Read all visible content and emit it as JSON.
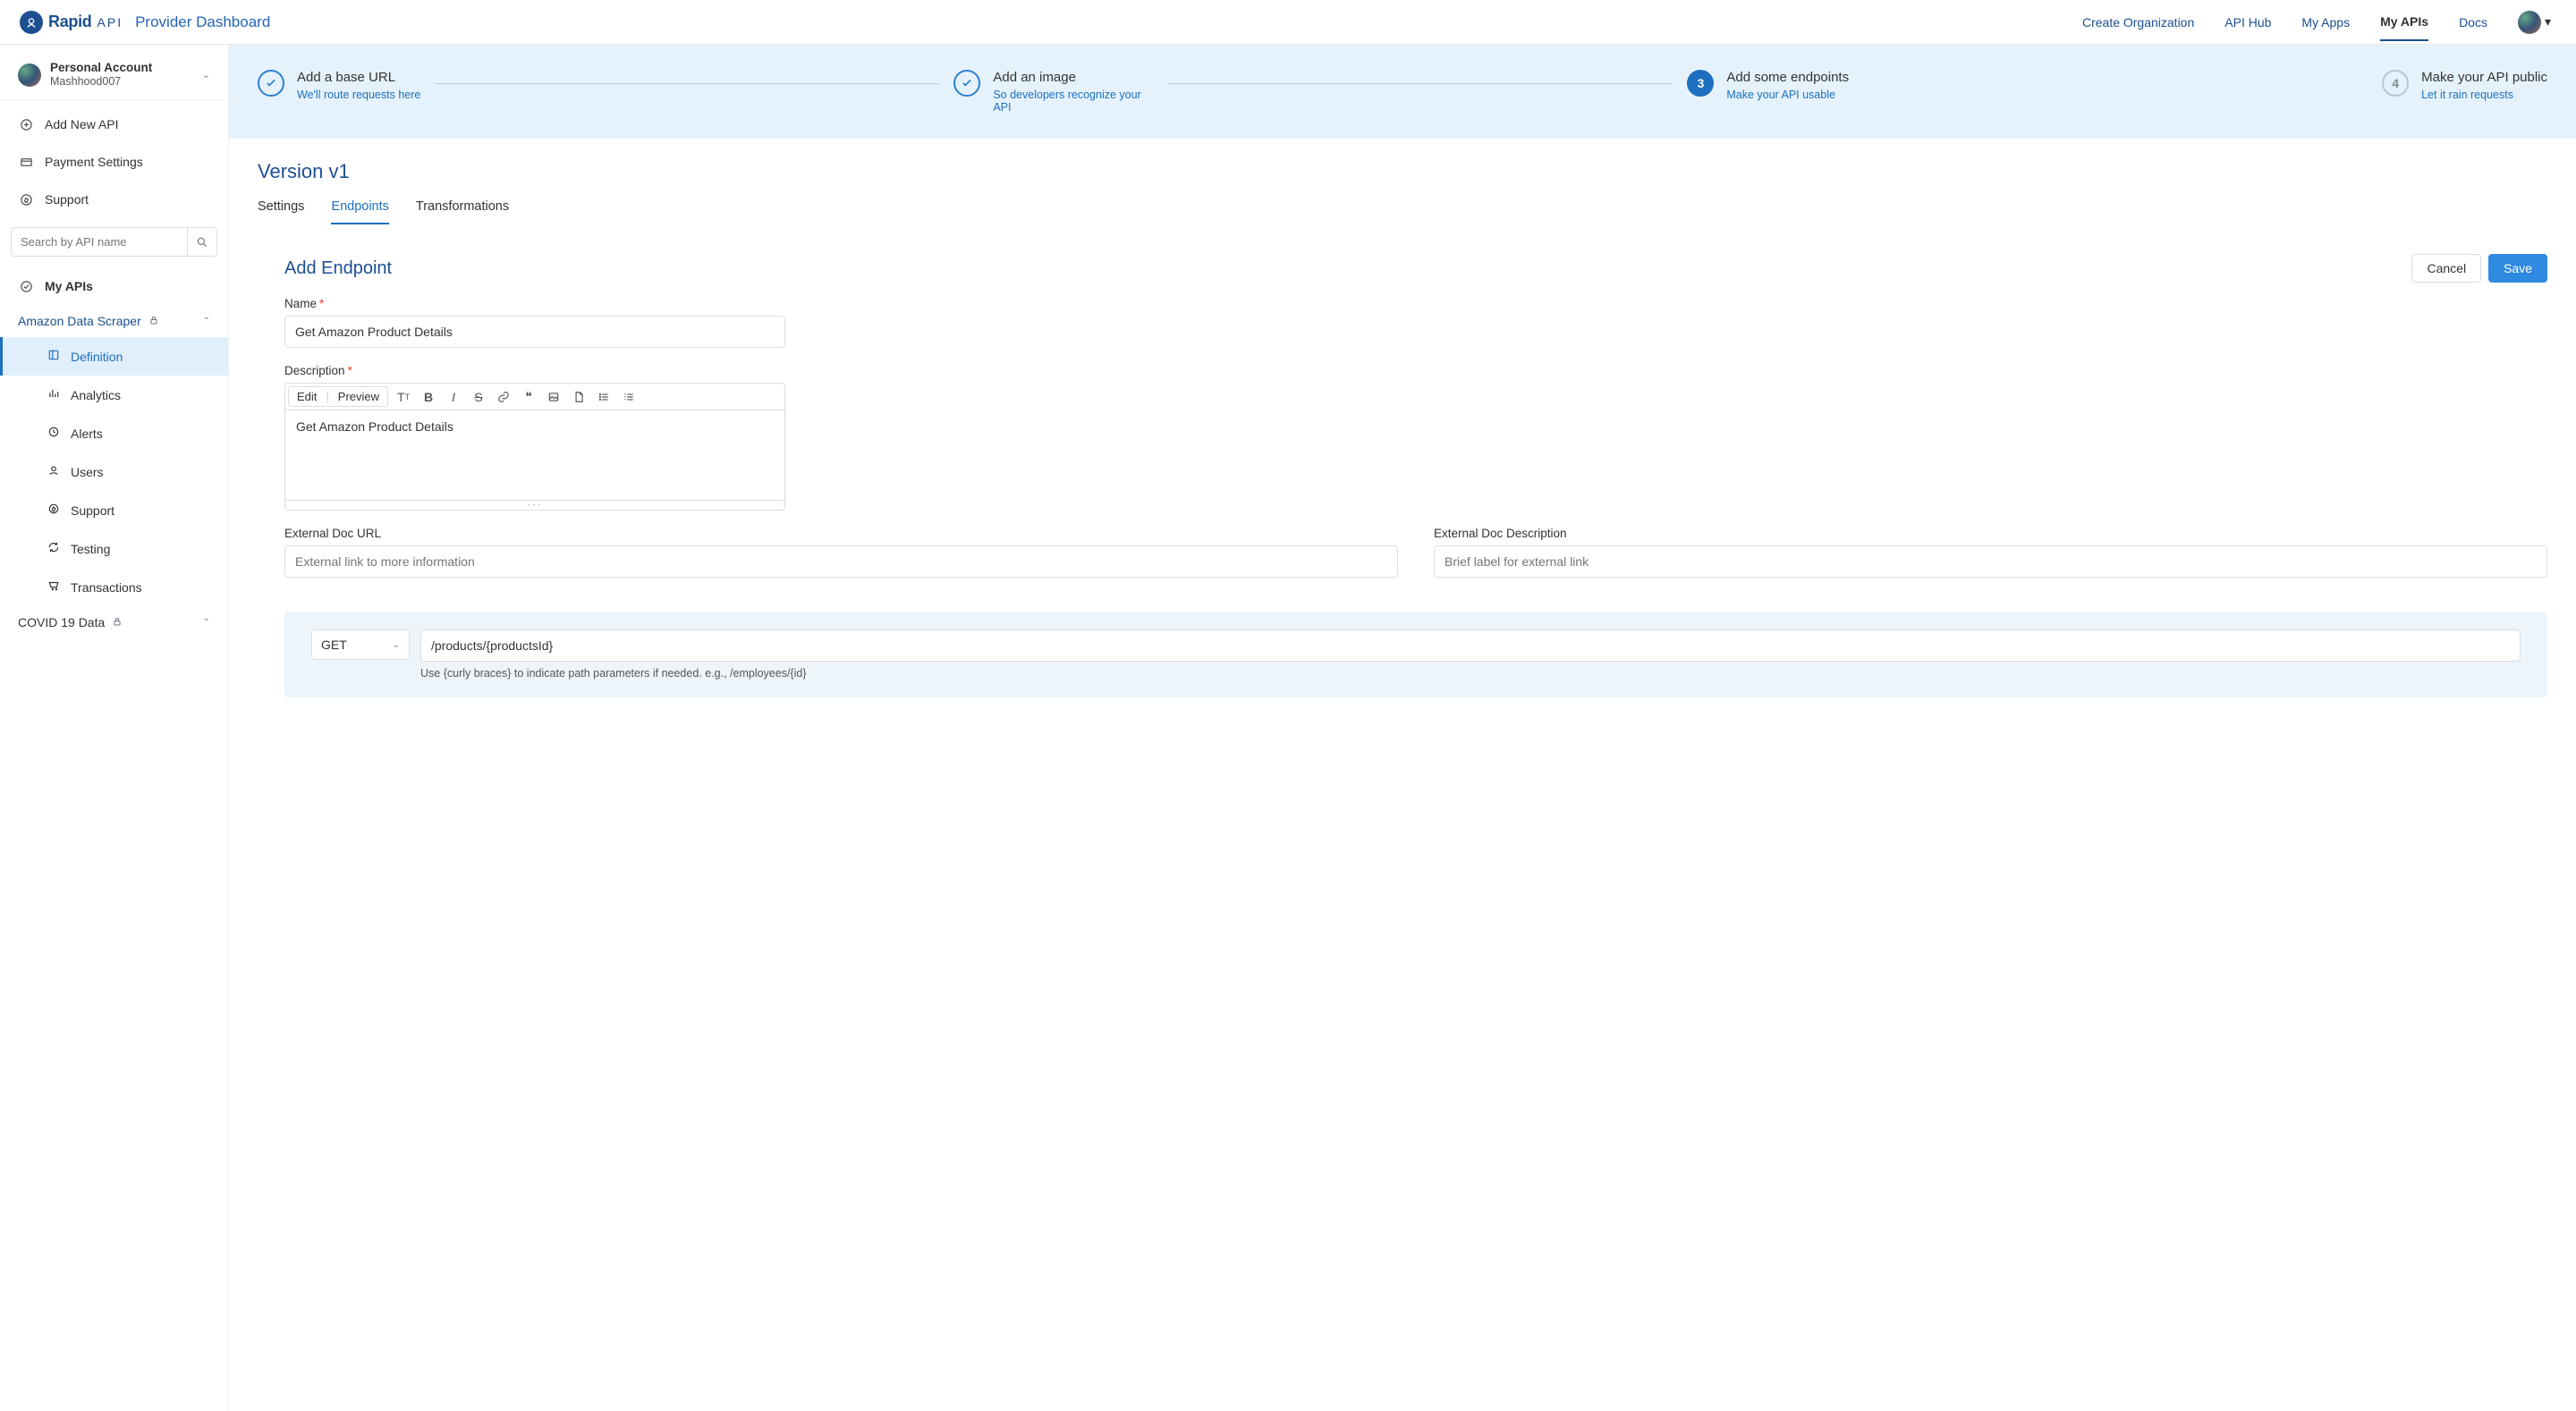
{
  "brand": {
    "name": "Rapid",
    "suffix": "API",
    "dashboard": "Provider Dashboard"
  },
  "nav": {
    "create_org": "Create Organization",
    "api_hub": "API Hub",
    "my_apps": "My Apps",
    "my_apis": "My APIs",
    "docs": "Docs"
  },
  "account": {
    "title": "Personal Account",
    "user": "Mashhood007"
  },
  "sidebar": {
    "add_api": "Add New API",
    "payment": "Payment Settings",
    "support": "Support",
    "search_ph": "Search by API name",
    "my_apis": "My APIs",
    "api_tree": {
      "name": "Amazon Data Scraper",
      "subs": {
        "definition": "Definition",
        "analytics": "Analytics",
        "alerts": "Alerts",
        "users": "Users",
        "support": "Support",
        "testing": "Testing",
        "transactions": "Transactions"
      }
    },
    "api_tree2": {
      "name": "COVID 19 Data"
    }
  },
  "steps": [
    {
      "title": "Add a base URL",
      "sub": "We'll route requests here"
    },
    {
      "title": "Add an image",
      "sub": "So developers recognize your API"
    },
    {
      "title": "Add some endpoints",
      "sub": "Make your API usable",
      "num": "3"
    },
    {
      "title": "Make your API public",
      "sub": "Let it rain requests",
      "num": "4"
    }
  ],
  "version": "Version v1",
  "tabs": {
    "settings": "Settings",
    "endpoints": "Endpoints",
    "transformations": "Transformations"
  },
  "form": {
    "heading": "Add Endpoint",
    "cancel": "Cancel",
    "save": "Save",
    "name_label": "Name",
    "name_value": "Get Amazon Product Details",
    "desc_label": "Description",
    "desc_value": "Get Amazon Product Details",
    "edit": "Edit",
    "preview": "Preview",
    "ext_url_label": "External Doc URL",
    "ext_url_ph": "External link to more information",
    "ext_desc_label": "External Doc Description",
    "ext_desc_ph": "Brief label for external link",
    "method": "GET",
    "path": "/products/{productsId}",
    "path_hint": "Use {curly braces} to indicate path parameters if needed. e.g., /employees/{id}"
  }
}
